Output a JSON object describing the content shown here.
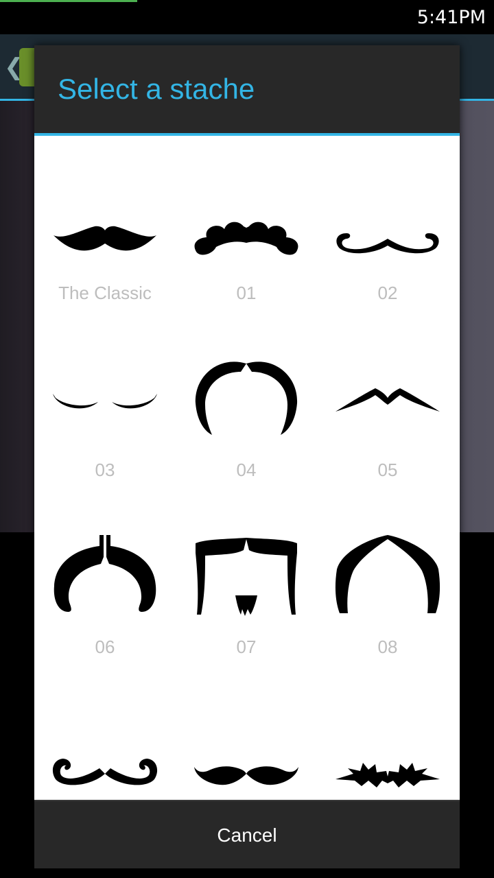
{
  "status_bar": {
    "time": "5:41PM"
  },
  "dialog": {
    "title": "Select a stache",
    "cancel_label": "Cancel",
    "options": [
      {
        "label": "The Classic",
        "icon": "classic-mustache-icon"
      },
      {
        "label": "01",
        "icon": "curly-bumpy-mustache-icon"
      },
      {
        "label": "02",
        "icon": "handlebar-curl-mustache-icon"
      },
      {
        "label": "03",
        "icon": "thin-pencil-mustache-icon"
      },
      {
        "label": "04",
        "icon": "horseshoe-mustache-icon"
      },
      {
        "label": "05",
        "icon": "chevron-thin-mustache-icon"
      },
      {
        "label": "06",
        "icon": "walrus-split-mustache-icon"
      },
      {
        "label": "07",
        "icon": "fu-manchu-goatee-icon"
      },
      {
        "label": "08",
        "icon": "arched-horseshoe-mustache-icon"
      },
      {
        "label": "",
        "icon": "swirl-handlebar-mustache-icon"
      },
      {
        "label": "",
        "icon": "wavy-mustache-icon"
      },
      {
        "label": "",
        "icon": "spiky-mustache-icon"
      }
    ]
  },
  "colors": {
    "accent": "#33b5e5",
    "dialog_bar": "#282828",
    "label": "#bdbdbd"
  }
}
